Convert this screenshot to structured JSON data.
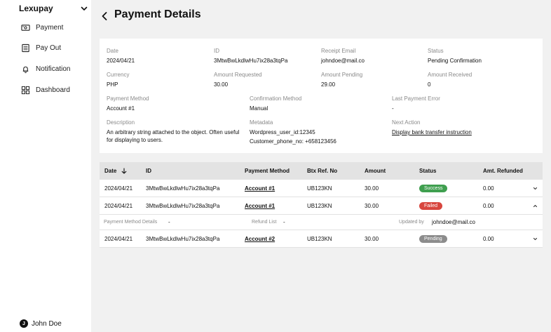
{
  "sidebar": {
    "brand": "Lexupay",
    "items": [
      {
        "label": "Payment",
        "icon": "cash-icon"
      },
      {
        "label": "Pay Out",
        "icon": "receipt-icon"
      },
      {
        "label": "Notification",
        "icon": "bell-icon"
      },
      {
        "label": "Dashboard",
        "icon": "dashboard-icon"
      }
    ],
    "user": {
      "initial": "J",
      "name": "John Doe"
    }
  },
  "header": {
    "title": "Payment Details"
  },
  "details": {
    "date": {
      "label": "Date",
      "value": "2024/04/21"
    },
    "id": {
      "label": "ID",
      "value": "3MtwBwLkdlwHu7ix28a3tqPa"
    },
    "receipt_email": {
      "label": "Receipt Email",
      "value": "johndoe@mail.co"
    },
    "status": {
      "label": "Status",
      "value": "Pending Confirmation"
    },
    "currency": {
      "label": "Currency",
      "value": "PHP"
    },
    "amount_requested": {
      "label": "Amount Requested",
      "value": "30.00"
    },
    "amount_pending": {
      "label": "Amount Pending",
      "value": "29.00"
    },
    "amount_received": {
      "label": "Amount Received",
      "value": "0"
    },
    "payment_method": {
      "label": "Payment Method",
      "value": "Account #1"
    },
    "confirmation_method": {
      "label": "Confirmation Method",
      "value": "Manual"
    },
    "last_payment_error": {
      "label": "Last Payment Error",
      "value": "-"
    },
    "description": {
      "label": "Description",
      "value": "An arbitrary string attached to the object. Often useful for displaying to users."
    },
    "metadata": {
      "label": "Metadata",
      "line1": "Wordpress_user_id:12345",
      "line2": "Customer_phone_no: +658123456"
    },
    "next_action": {
      "label": "Next Action",
      "value": "Display bank transfer instruction"
    }
  },
  "table": {
    "columns": {
      "date": "Date",
      "id": "ID",
      "payment_method": "Payment Method",
      "btx_ref": "Btx Ref. No",
      "amount": "Amount",
      "status": "Status",
      "amt_refunded": "Amt. Refunded"
    },
    "rows": [
      {
        "date": "2024/04/21",
        "id": "3MtwBwLkdlwHu7ix28a3tqPa",
        "payment_method": "Account #1",
        "btx_ref": "UB123KN",
        "amount": "30.00",
        "status": "Success",
        "amt_refunded": "0.00"
      },
      {
        "date": "2024/04/21",
        "id": "3MtwBwLkdlwHu7ix28a3tqPa",
        "payment_method": "Account #1",
        "btx_ref": "UB123KN",
        "amount": "30.00",
        "status": "Failed",
        "amt_refunded": "0.00"
      },
      {
        "date": "2024/04/21",
        "id": "3MtwBwLkdlwHu7ix28a3tqPa",
        "payment_method": "Account #2",
        "btx_ref": "UB123KN",
        "amount": "30.00",
        "status": "Pending",
        "amt_refunded": "0.00"
      }
    ],
    "expanded": {
      "payment_method_details_label": "Payment Method Details",
      "payment_method_details_value": "-",
      "refund_list_label": "Refund List",
      "refund_list_value": "-",
      "updated_by_label": "Updated by",
      "updated_by_value": "johndoe@mail.co"
    }
  },
  "colors": {
    "success": "#3f9f4f",
    "failed": "#d8463e",
    "pending": "#8c8c8c",
    "header_bg": "#e3e3e3",
    "page_bg": "#f1f1f1"
  }
}
